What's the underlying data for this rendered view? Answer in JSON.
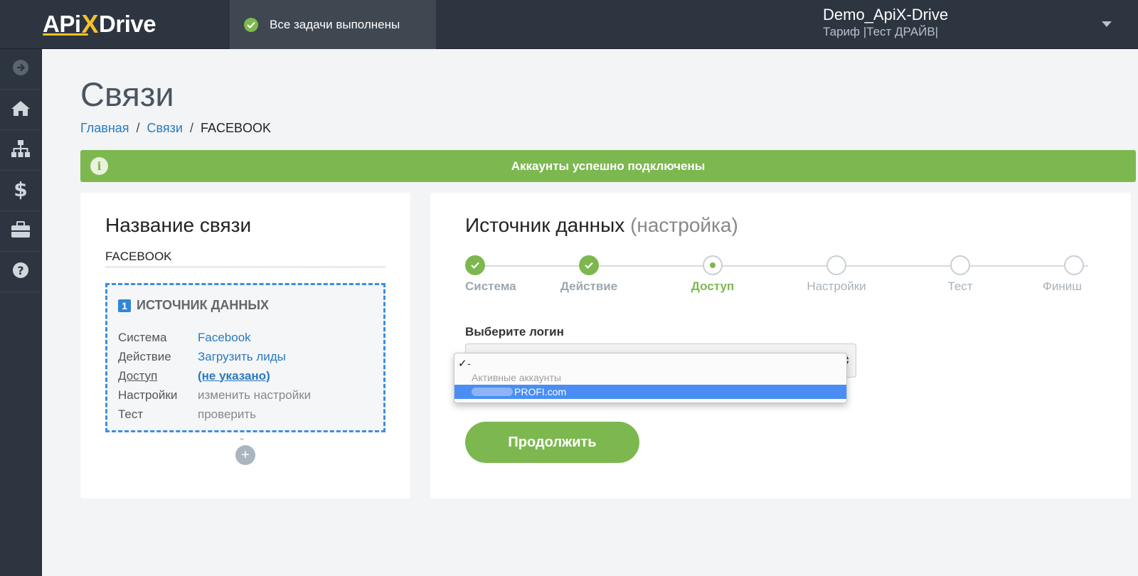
{
  "header": {
    "logo_left": "APi",
    "logo_x": "X",
    "logo_right": "Drive",
    "status_text": "Все задачи выполнены",
    "user_name": "Demo_ApiX-Drive",
    "user_plan": "Тариф |Тест ДРАЙВ|"
  },
  "sidebar": {
    "items": [
      {
        "icon": "arrow-right-circle-icon"
      },
      {
        "icon": "home-icon"
      },
      {
        "icon": "sitemap-icon"
      },
      {
        "icon": "dollar-icon"
      },
      {
        "icon": "briefcase-icon"
      },
      {
        "icon": "help-icon"
      }
    ]
  },
  "page": {
    "title": "Связи",
    "breadcrumb": {
      "home": "Главная",
      "links": "Связи",
      "current": "FACEBOOK",
      "sep": "/"
    },
    "alert": "Аккаунты успешно подключены"
  },
  "left_card": {
    "title": "Название связи",
    "name_value": "FACEBOOK",
    "source": {
      "number": "1",
      "title": "ИСТОЧНИК ДАННЫХ",
      "rows": [
        {
          "key": "Система",
          "value": "Facebook"
        },
        {
          "key": "Действие",
          "value": "Загрузить лиды"
        },
        {
          "key": "Доступ",
          "value": "(не указано)"
        },
        {
          "key": "Настройки",
          "value": "изменить настройки"
        },
        {
          "key": "Тест",
          "value": "проверить"
        }
      ]
    },
    "add_symbol": "+"
  },
  "right_card": {
    "title": "Источник данных",
    "title_muted": "(настройка)",
    "steps": [
      {
        "label": "Система",
        "state": "done"
      },
      {
        "label": "Действие",
        "state": "done"
      },
      {
        "label": "Доступ",
        "state": "active"
      },
      {
        "label": "Настройки",
        "state": "pending"
      },
      {
        "label": "Тест",
        "state": "pending"
      },
      {
        "label": "Финиш",
        "state": "pending"
      }
    ],
    "login_label": "Выберите логин",
    "dropdown": {
      "selected": "-",
      "group_label": "Активные аккаунты",
      "option": "PROFI.com"
    },
    "continue_label": "Продолжить"
  },
  "colors": {
    "accent_green": "#7cb84f",
    "link_blue": "#2979c0",
    "dark_bg": "#2d3540",
    "highlight_blue": "#4a8ef3"
  }
}
